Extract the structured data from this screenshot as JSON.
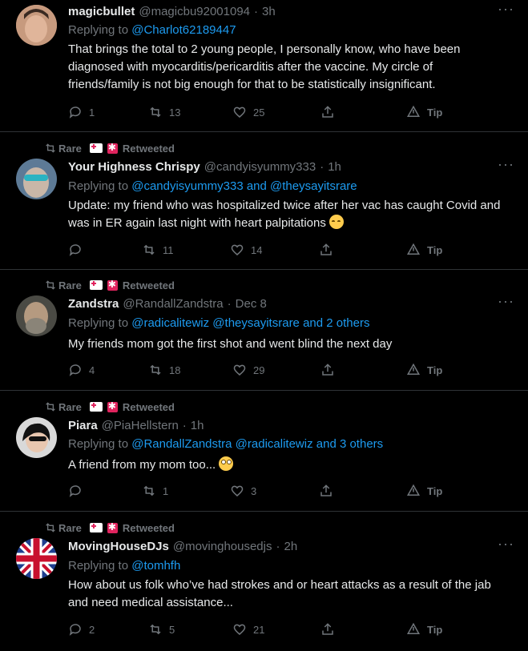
{
  "tweets": [
    {
      "retweet": null,
      "name": "magicbullet",
      "handle": "@magicbu92001094",
      "sep": "·",
      "time": "3h",
      "reply_prefix": "Replying to",
      "reply_to": "@Charlot62189447",
      "text": "That brings the total to 2 young people, I personally know, who have been diagnosed with myocarditis/pericarditis after the vaccine.  My circle of friends/family is not big enough for that to be statistically insignificant.",
      "emoji": "",
      "reply_count": "1",
      "retweet_count": "13",
      "like_count": "25",
      "tip": "Tip",
      "avatar_color": "#8a5a44"
    },
    {
      "retweet": {
        "name": "Rare",
        "suffix": "Retweeted"
      },
      "name": "Your Highness Chrispy",
      "handle": "@candyisyummy333",
      "sep": "·",
      "time": "1h",
      "reply_prefix": "Replying to",
      "reply_to": "@candyisyummy333 and @theysayitsrare",
      "text": "Update: my friend who was hospitalized twice after her vac has caught Covid and was in ER again last night with heart palpitations",
      "emoji": "relieved",
      "reply_count": "",
      "retweet_count": "11",
      "like_count": "14",
      "tip": "Tip",
      "avatar_color": "#6f8fb0"
    },
    {
      "retweet": {
        "name": "Rare",
        "suffix": "Retweeted"
      },
      "name": "Zandstra",
      "handle": "@RandallZandstra",
      "sep": "·",
      "time": "Dec 8",
      "reply_prefix": "Replying to",
      "reply_to": "@radicalitewiz @theysayitsrare and 2 others",
      "text": "My friends mom got the first shot and went blind the next day",
      "emoji": "",
      "reply_count": "4",
      "retweet_count": "18",
      "like_count": "29",
      "tip": "Tip",
      "avatar_color": "#7a6a55"
    },
    {
      "retweet": {
        "name": "Rare",
        "suffix": "Retweeted"
      },
      "name": "Piara",
      "handle": "@PiaHellstern",
      "sep": "·",
      "time": "1h",
      "reply_prefix": "Replying to",
      "reply_to": "@RandallZandstra @radicalitewiz and 3 others",
      "text": "A friend from my mom too...",
      "emoji": "flushed",
      "reply_count": "",
      "retweet_count": "1",
      "like_count": "3",
      "tip": "Tip",
      "avatar_color": "#9a9a9a"
    },
    {
      "retweet": {
        "name": "Rare",
        "suffix": "Retweeted"
      },
      "name": "MovingHouseDJs",
      "handle": "@movinghousedjs",
      "sep": "·",
      "time": "2h",
      "reply_prefix": "Replying to",
      "reply_to": "@tomhfh",
      "text": "How about us folk who’ve had strokes and or heart attacks as a result of the jab and need medical assistance...",
      "emoji": "",
      "reply_count": "2",
      "retweet_count": "5",
      "like_count": "21",
      "tip": "Tip",
      "avatar_color": "#1f3f8f"
    }
  ]
}
